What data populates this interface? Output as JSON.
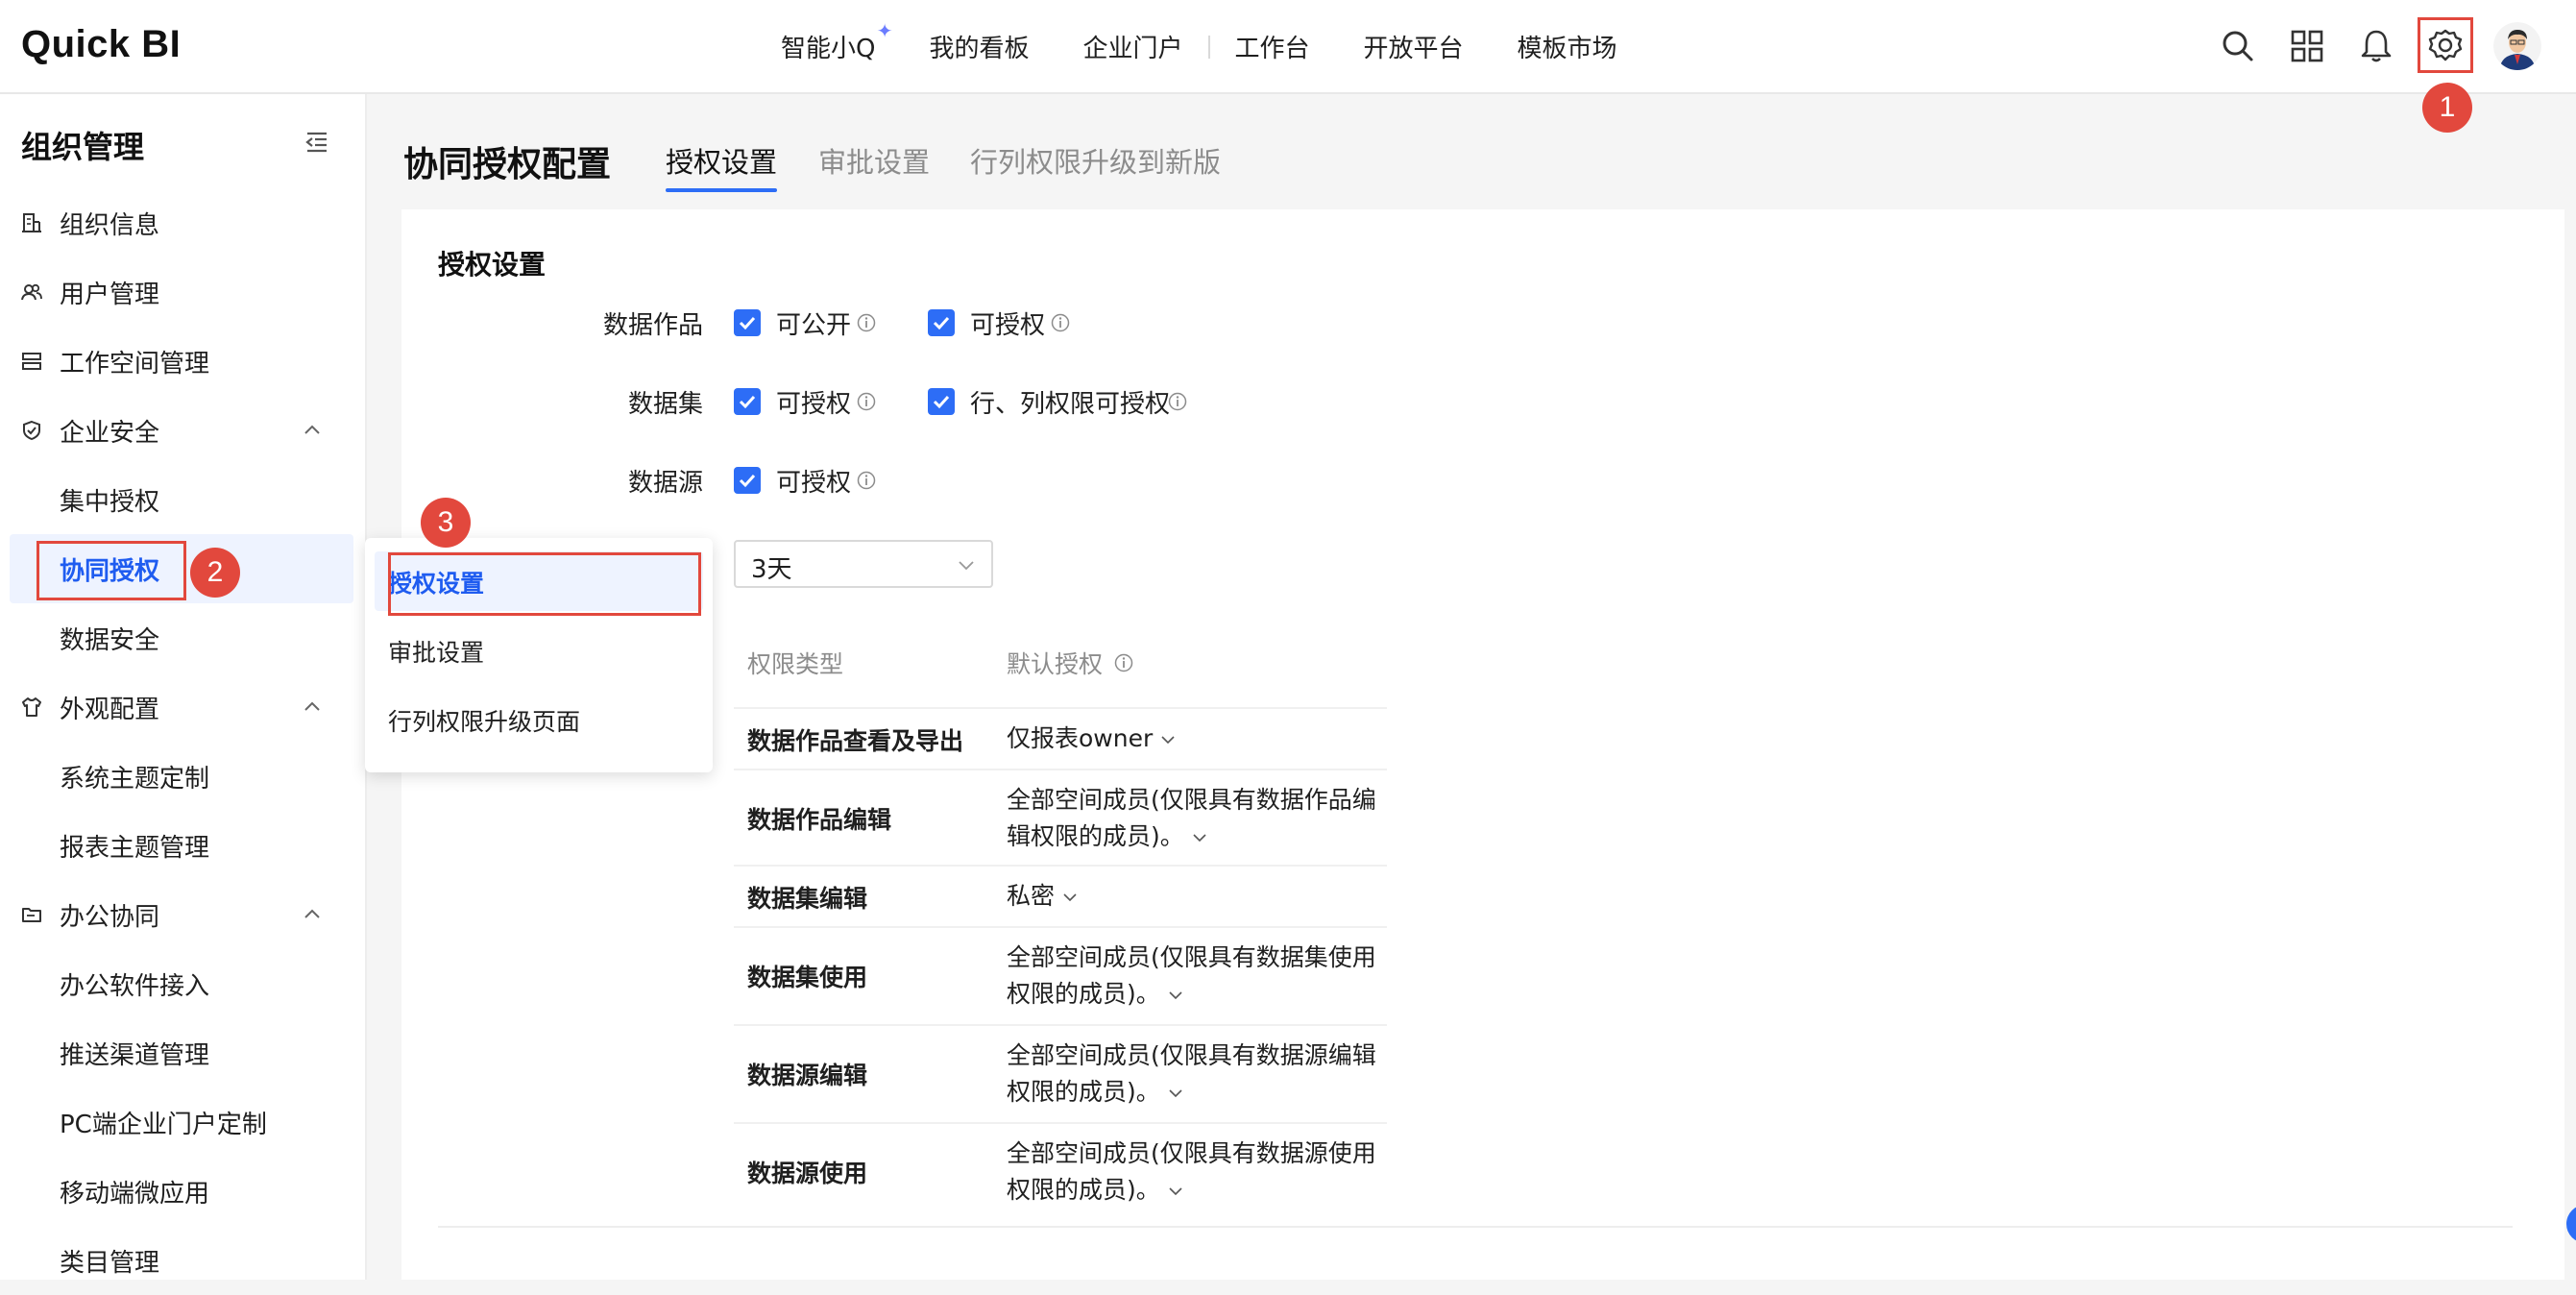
{
  "header": {
    "logo": "Quick BI",
    "nav": [
      "智能小Q",
      "我的看板",
      "企业门户",
      "工作台",
      "开放平台",
      "模板市场"
    ],
    "icons": [
      "search-icon",
      "apps-grid-icon",
      "bell-icon",
      "gear-icon",
      "user-avatar"
    ]
  },
  "sidebar": {
    "title": "组织管理",
    "items": [
      {
        "label": "组织信息",
        "icon": "building-icon"
      },
      {
        "label": "用户管理",
        "icon": "users-icon"
      },
      {
        "label": "工作空间管理",
        "icon": "workspace-icon"
      },
      {
        "label": "企业安全",
        "icon": "shield-icon"
      },
      {
        "label": "集中授权"
      },
      {
        "label": "协同授权"
      },
      {
        "label": "数据安全"
      },
      {
        "label": "外观配置",
        "icon": "shirt-icon"
      },
      {
        "label": "系统主题定制"
      },
      {
        "label": "报表主题管理"
      },
      {
        "label": "办公协同",
        "icon": "folder-icon"
      },
      {
        "label": "办公软件接入"
      },
      {
        "label": "推送渠道管理"
      },
      {
        "label": "PC端企业门户定制"
      },
      {
        "label": "移动端微应用"
      },
      {
        "label": "类目管理"
      }
    ]
  },
  "main": {
    "title": "协同授权配置",
    "tabs": [
      "授权设置",
      "审批设置",
      "行列权限升级到新版"
    ]
  },
  "card": {
    "title": "授权设置",
    "rows": [
      {
        "label": "数据作品",
        "options": [
          "可公开",
          "可授权"
        ]
      },
      {
        "label": "数据集",
        "options": [
          "可授权",
          "行、列权限可授权"
        ]
      },
      {
        "label": "数据源",
        "options": [
          "可授权"
        ]
      }
    ],
    "select_value": "3天",
    "table": {
      "headers": [
        "权限类型",
        "默认授权"
      ],
      "rows": [
        [
          "数据作品查看及导出",
          "仅报表owner"
        ],
        [
          "数据作品编辑",
          "全部空间成员(仅限具有数据作品编辑权限的成员)。"
        ],
        [
          "数据集编辑",
          "私密"
        ],
        [
          "数据集使用",
          "全部空间成员(仅限具有数据集使用权限的成员)。"
        ],
        [
          "数据源编辑",
          "全部空间成员(仅限具有数据源编辑权限的成员)。"
        ],
        [
          "数据源使用",
          "全部空间成员(仅限具有数据源使用权限的成员)。"
        ]
      ]
    }
  },
  "dropdown": {
    "items": [
      "授权设置",
      "审批设置",
      "行列权限升级页面"
    ]
  },
  "annotations": {
    "badges": [
      "1",
      "2",
      "3"
    ],
    "highlight_color": "#e2483d"
  },
  "colors": {
    "accent": "#2d6df6",
    "active_text": "#1f5cf0",
    "active_bg": "#eef3ff"
  }
}
